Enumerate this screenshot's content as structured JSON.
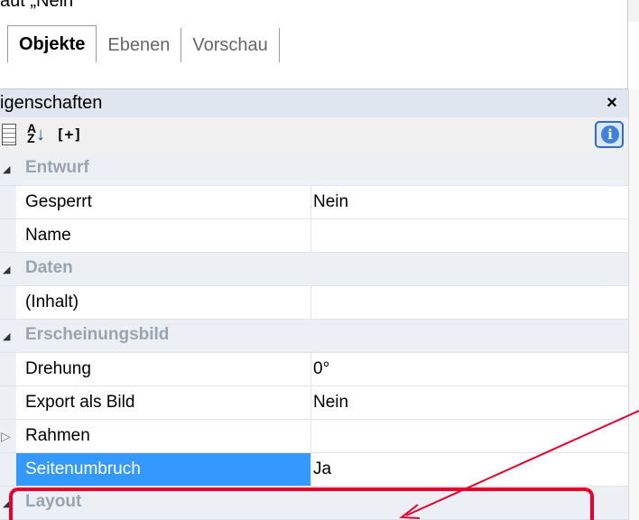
{
  "top_clip_text": "aut „Nein\"",
  "tabs": [
    {
      "label": "Objekte",
      "active": true
    },
    {
      "label": "Ebenen",
      "active": false
    },
    {
      "label": "Vorschau",
      "active": false
    }
  ],
  "panel": {
    "title": "igenschaften",
    "close_label": "×",
    "toolbar": {
      "categorized_icon": "categorized-list-icon",
      "sort_label": "A↓Z",
      "expand_label": "[+]",
      "info_label": "i"
    }
  },
  "properties": [
    {
      "type": "category",
      "label": "Entwurf"
    },
    {
      "type": "prop",
      "name": "Gesperrt",
      "value": "Nein"
    },
    {
      "type": "prop",
      "name": "Name",
      "value": ""
    },
    {
      "type": "category",
      "label": "Daten"
    },
    {
      "type": "prop",
      "name": "(Inhalt)",
      "value": ""
    },
    {
      "type": "category",
      "label": "Erscheinungsbild"
    },
    {
      "type": "prop",
      "name": "Drehung",
      "value": "0°"
    },
    {
      "type": "prop",
      "name": "Export als Bild",
      "value": "Nein"
    },
    {
      "type": "prop",
      "name": "Rahmen",
      "value": "",
      "expandable": true
    },
    {
      "type": "prop",
      "name": "Seitenumbruch",
      "value": "Ja",
      "selected": true
    },
    {
      "type": "category",
      "label": "Layout"
    }
  ],
  "colors": {
    "highlight": "#e8002c",
    "selection": "#3399ff",
    "category_bg": "#ecf0f5"
  }
}
